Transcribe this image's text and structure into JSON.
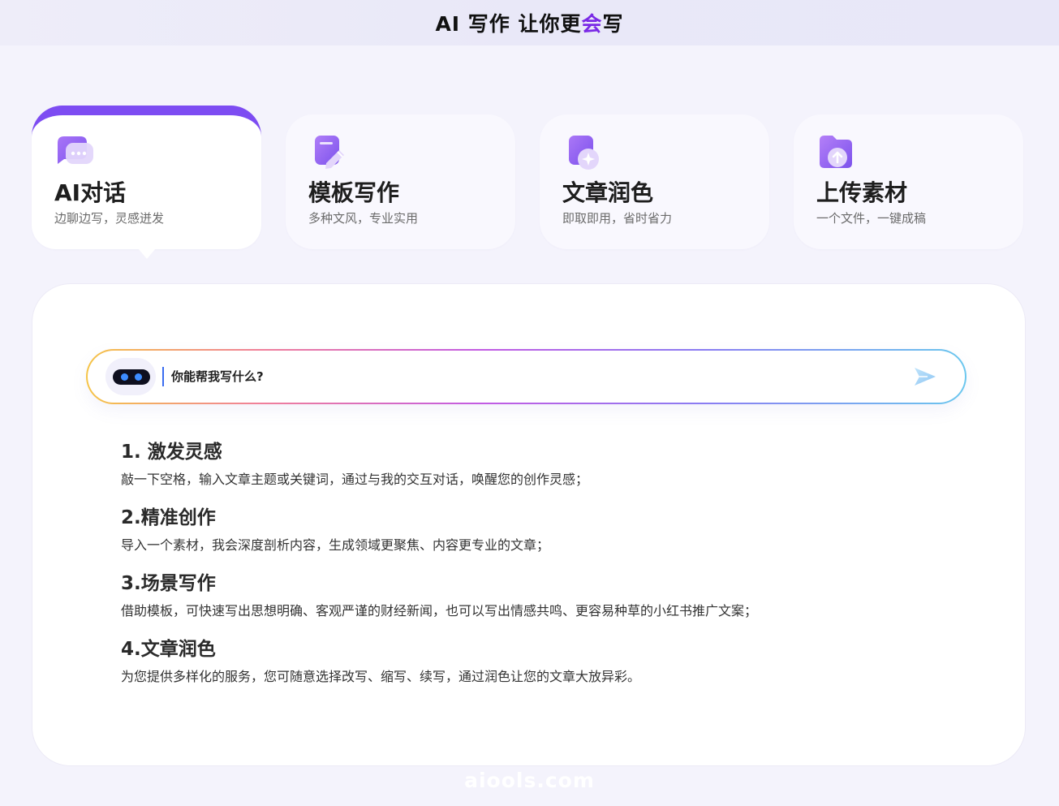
{
  "header": {
    "title_prefix": "AI 写作 让你更",
    "title_accent": "会",
    "title_suffix": "写",
    "accent_color": "#7a29e6"
  },
  "features": [
    {
      "title": "AI对话",
      "subtitle": "边聊边写，灵感迸发",
      "icon": "chat-bubble-icon",
      "active": true
    },
    {
      "title": "模板写作",
      "subtitle": "多种文风，专业实用",
      "icon": "document-edit-icon",
      "active": false
    },
    {
      "title": "文章润色",
      "subtitle": "即取即用，省时省力",
      "icon": "sparkle-document-icon",
      "active": false
    },
    {
      "title": "上传素材",
      "subtitle": "一个文件，一键成稿",
      "icon": "upload-folder-icon",
      "active": false
    }
  ],
  "chat": {
    "placeholder": "你能帮我写什么?",
    "avatar_icon": "robot-icon",
    "send_icon": "send-icon"
  },
  "tips": [
    {
      "title": "1. 激发灵感",
      "description": "敲一下空格，输入文章主题或关键词，通过与我的交互对话，唤醒您的创作灵感；"
    },
    {
      "title": "2.精准创作",
      "description": "导入一个素材，我会深度剖析内容，生成领域更聚焦、内容更专业的文章；"
    },
    {
      "title": "3.场景写作",
      "description": "借助模板，可快速写出思想明确、客观严谨的财经新闻，也可以写出情感共鸣、更容易种草的小红书推广文案；"
    },
    {
      "title": "4.文章润色",
      "description": "为您提供多样化的服务，您可随意选择改写、缩写、续写，通过润色让您的文章大放异彩。"
    }
  ],
  "watermark": "aiools.com",
  "colors": {
    "brand_purple": "#7d4cf2",
    "page_background": "#f4f3fc"
  }
}
